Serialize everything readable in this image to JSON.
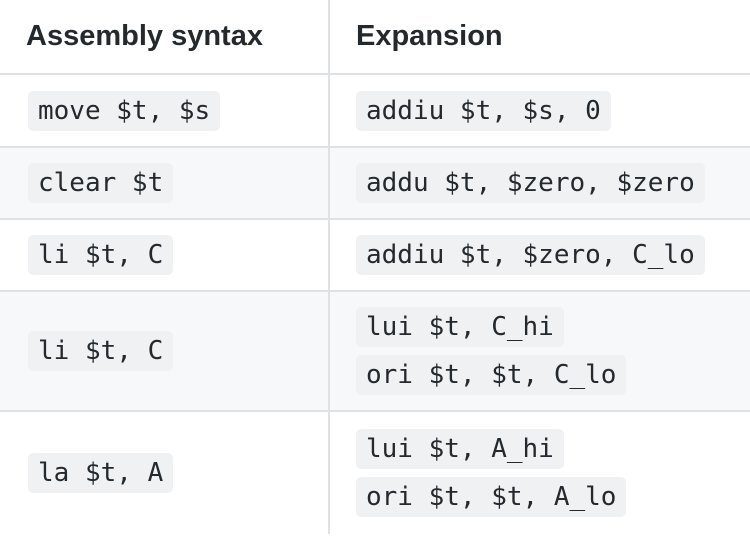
{
  "table": {
    "headers": [
      "Assembly syntax",
      "Expansion"
    ],
    "rows": [
      {
        "syntax": "move $t, $s",
        "expansion": [
          "addiu $t, $s, 0"
        ]
      },
      {
        "syntax": "clear $t",
        "expansion": [
          "addu $t, $zero, $zero"
        ]
      },
      {
        "syntax": "li $t, C",
        "expansion": [
          "addiu $t, $zero, C_lo"
        ]
      },
      {
        "syntax": "li $t, C",
        "expansion": [
          "lui $t, C_hi",
          "ori $t, $t, C_lo"
        ]
      },
      {
        "syntax": "la $t, A",
        "expansion": [
          "lui $t, A_hi",
          "ori $t, $t, A_lo"
        ]
      }
    ]
  }
}
